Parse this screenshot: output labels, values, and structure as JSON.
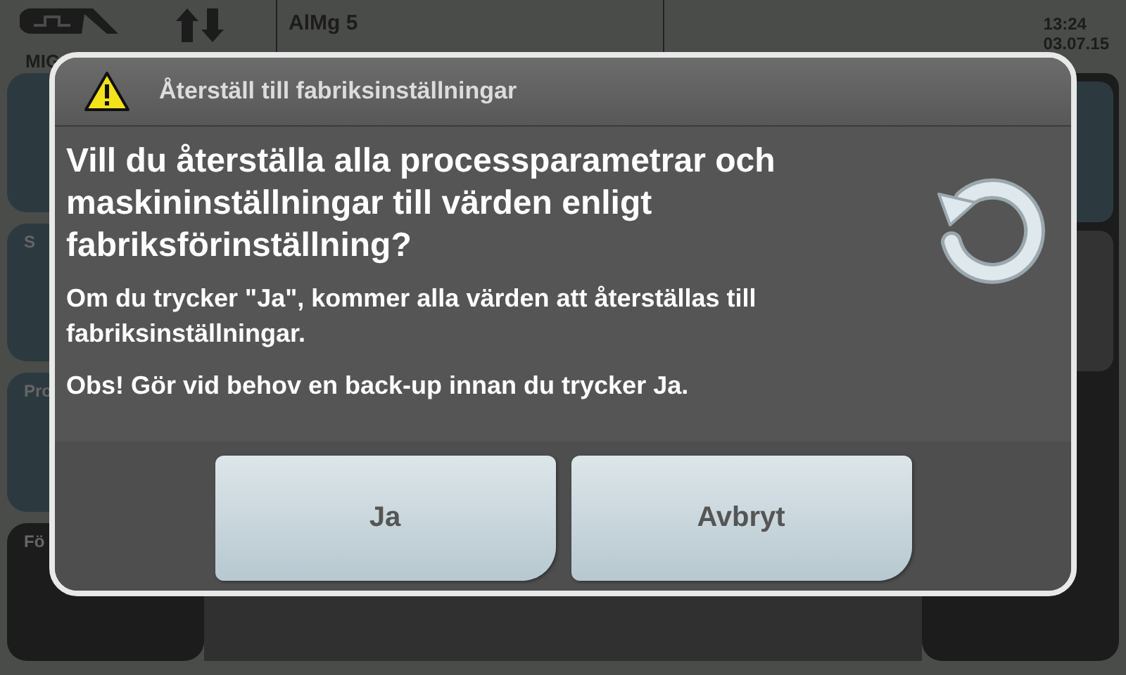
{
  "status_bar": {
    "mode": "MIG",
    "material": "AlMg 5",
    "time": "13:24",
    "date": "03.07.15"
  },
  "side_panels": [
    {
      "kind": "teal"
    },
    {
      "kind": "teal",
      "label": "S"
    },
    {
      "kind": "teal",
      "label": "Pro"
    },
    {
      "kind": "dark",
      "label": "Fö"
    }
  ],
  "dialog": {
    "title": "Återställ till fabriksinställningar",
    "question": "Vill du återställa alla processparametrar och maskininställningar till värden enligt fabriksförinställning?",
    "paragraphs": [
      "Om du trycker \"Ja\", kommer alla värden att återställas till fabriksinställningar.",
      "Obs! Gör vid behov en back-up innan du trycker Ja."
    ],
    "buttons": [
      "Ja",
      "Avbryt"
    ]
  }
}
